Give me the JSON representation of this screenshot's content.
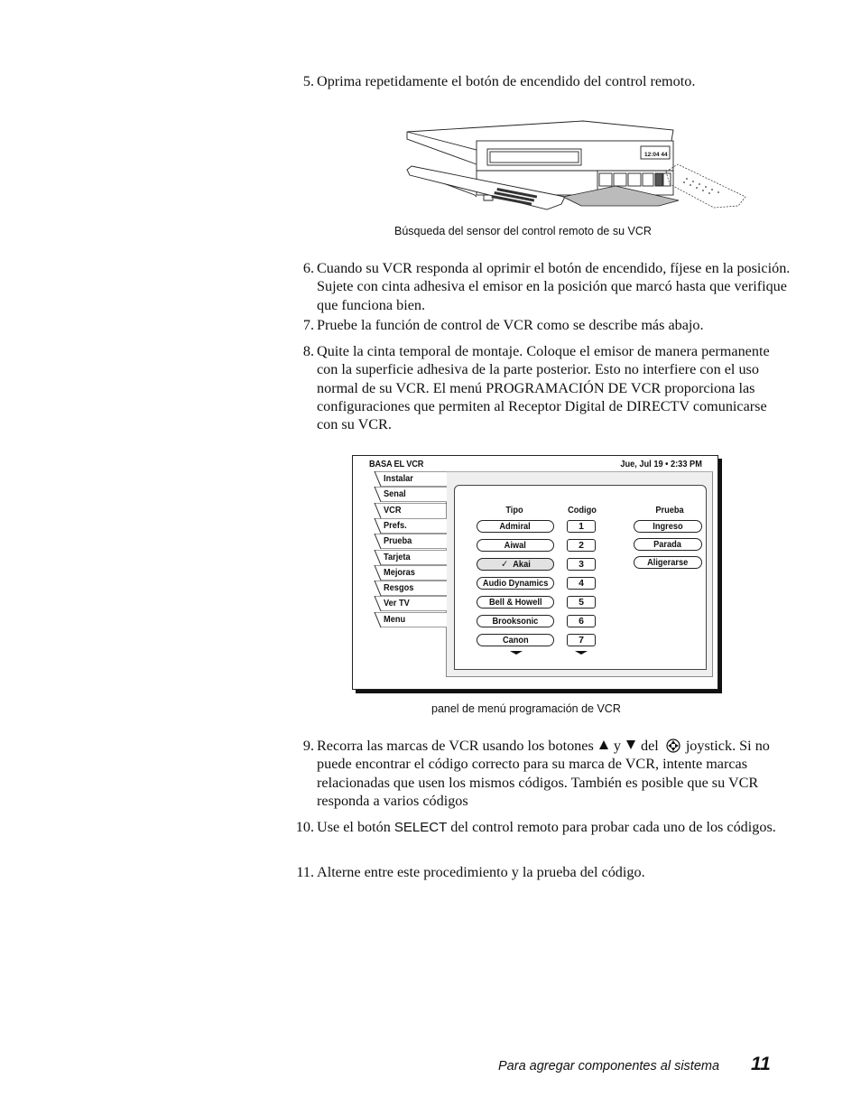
{
  "steps": [
    {
      "number": "5.",
      "text": "Oprima repetidamente el botón de encendido del control remoto."
    },
    {
      "number": "6.",
      "text": "Cuando su VCR responda al oprimir el botón de encendido, fíjese en la posición. Sujete con cinta adhesiva el emisor en la posición que marcó hasta que verifique que funciona bien."
    },
    {
      "number": "7.",
      "text": "Pruebe la función de control de VCR como se describe más abajo."
    },
    {
      "number": "8.",
      "text": "Quite la cinta temporal de montaje. Coloque el emisor de manera permanente con la superficie adhesiva de la parte posterior. Esto no interfiere con el uso normal de su VCR. El menú PROGRAMACIÓN DE VCR proporciona las configuraciones que permiten al Receptor Digital de DIRECTV comunicarse con su VCR."
    },
    {
      "number": "9.",
      "text_before": "Recorra las marcas de VCR usando  los botones",
      "text_y": "y",
      "text_del": "del",
      "text_after": "joystick. Si no puede encontrar el código correcto para su marca de VCR, intente marcas relacionadas que usen los mismos códigos. También es posible que su VCR responda a varios códigos",
      "icons": [
        "up-triangle-icon",
        "down-triangle-icon",
        "joystick-icon"
      ]
    },
    {
      "number": "10.",
      "text_before": "Use el botón",
      "button_name": "SELECT",
      "text_after": "del control remoto para probar cada uno de los códigos."
    },
    {
      "number": "11.",
      "text": "Alterne entre este procedimiento y la prueba del código."
    }
  ],
  "figures": {
    "vcr": {
      "caption": "Búsqueda del sensor del control remoto de su VCR",
      "display_text": "12:04 44"
    },
    "menu": {
      "caption": "panel de menú programación de VCR",
      "title": "BASA EL VCR",
      "datetime": "Jue, Jul 19  • 2:33 PM",
      "tabs": [
        "Instalar",
        "Senal",
        "VCR",
        "Prefs.",
        "Prueba",
        "Tarjeta",
        "Mejoras",
        "Resgos",
        "Ver TV",
        "Menu"
      ],
      "active_tab": "VCR",
      "columns": {
        "tipo": {
          "header": "Tipo",
          "items": [
            "Admiral",
            "Aiwal",
            "Akai",
            "Audio Dynamics",
            "Bell & Howell",
            "Brooksonic",
            "Canon"
          ],
          "selected": "Akai",
          "check_mark": "✓"
        },
        "codigo": {
          "header": "Codigo",
          "items": [
            "1",
            "2",
            "3",
            "4",
            "5",
            "6",
            "7"
          ]
        },
        "prueba": {
          "header": "Prueba",
          "items": [
            "Ingreso",
            "Parada",
            "Aligerarse"
          ]
        }
      }
    }
  },
  "footer": {
    "section": "Para agregar componentes al sistema",
    "page_number": "11"
  }
}
